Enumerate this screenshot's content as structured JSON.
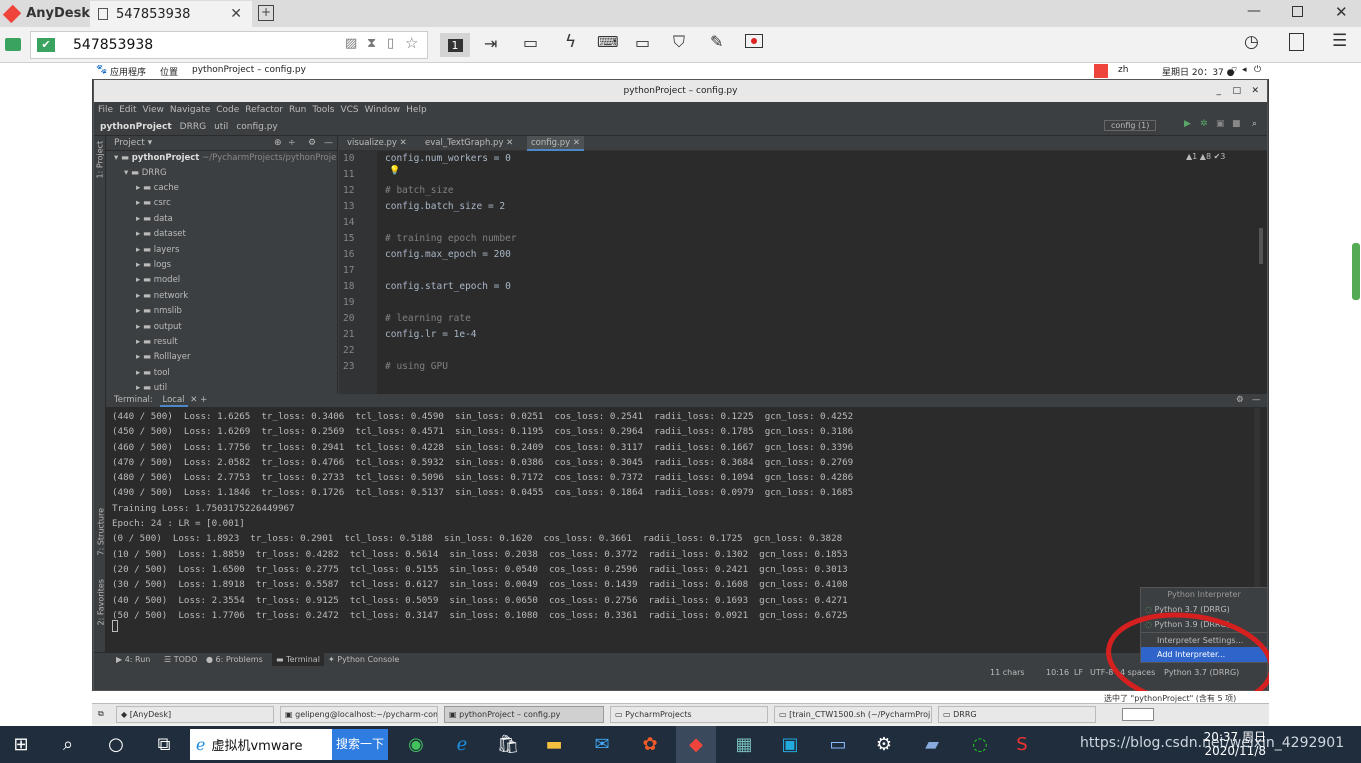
{
  "anydesk": {
    "app": "AnyDesk",
    "tab_id": "547853938",
    "address": "547853938",
    "monitor_num": "1"
  },
  "gnome": {
    "apps": "应用程序",
    "places": "位置",
    "window": "pythonProject – config.py",
    "lang": "zh",
    "clock": "星期日 20：37 ●"
  },
  "pycharm": {
    "title": "pythonProject – config.py",
    "menu": [
      "File",
      "Edit",
      "View",
      "Navigate",
      "Code",
      "Refactor",
      "Run",
      "Tools",
      "VCS",
      "Window",
      "Help"
    ],
    "breadcrumb": [
      "pythonProject",
      "DRRG",
      "util",
      "config.py"
    ],
    "run_config": "config (1)",
    "project_header": "Project",
    "root_name": "pythonProject",
    "root_path": "~/PycharmProjects/pythonProject",
    "drrg": "DRRG",
    "folders": [
      "cache",
      "csrc",
      "data",
      "dataset",
      "layers",
      "logs",
      "model",
      "network",
      "nmslib",
      "output",
      "result",
      "Rolllayer",
      "tool",
      "util"
    ],
    "tabs": [
      "visualize.py",
      "eval_TextGraph.py",
      "config.py"
    ],
    "inspect": "▲1 ▲8 ✔3",
    "lines": [
      {
        "n": "10",
        "code": "config.num_workers = 0"
      },
      {
        "n": "11",
        "code": ""
      },
      {
        "n": "12",
        "code": "# batch_size"
      },
      {
        "n": "13",
        "code": "config.batch_size = 2"
      },
      {
        "n": "14",
        "code": ""
      },
      {
        "n": "15",
        "code": "# training epoch number"
      },
      {
        "n": "16",
        "code": "config.max_epoch = 200"
      },
      {
        "n": "17",
        "code": ""
      },
      {
        "n": "18",
        "code": "config.start_epoch = 0"
      },
      {
        "n": "19",
        "code": ""
      },
      {
        "n": "20",
        "code": "# learning rate"
      },
      {
        "n": "21",
        "code": "config.lr = 1e-4"
      },
      {
        "n": "22",
        "code": ""
      },
      {
        "n": "23",
        "code": "# using GPU"
      }
    ],
    "terminal_label": "Terminal:",
    "terminal_tab": "Local",
    "term": [
      "(440 / 500)  Loss: 1.6265  tr_loss: 0.3406  tcl_loss: 0.4590  sin_loss: 0.0251  cos_loss: 0.2541  radii_loss: 0.1225  gcn_loss: 0.4252",
      "(450 / 500)  Loss: 1.6269  tr_loss: 0.2569  tcl_loss: 0.4571  sin_loss: 0.1195  cos_loss: 0.2964  radii_loss: 0.1785  gcn_loss: 0.3186",
      "(460 / 500)  Loss: 1.7756  tr_loss: 0.2941  tcl_loss: 0.4228  sin_loss: 0.2409  cos_loss: 0.3117  radii_loss: 0.1667  gcn_loss: 0.3396",
      "(470 / 500)  Loss: 2.0582  tr_loss: 0.4766  tcl_loss: 0.5932  sin_loss: 0.0386  cos_loss: 0.3045  radii_loss: 0.3684  gcn_loss: 0.2769",
      "(480 / 500)  Loss: 2.7753  tr_loss: 0.2733  tcl_loss: 0.5096  sin_loss: 0.7172  cos_loss: 0.7372  radii_loss: 0.1094  gcn_loss: 0.4286",
      "(490 / 500)  Loss: 1.1846  tr_loss: 0.1726  tcl_loss: 0.5137  sin_loss: 0.0455  cos_loss: 0.1864  radii_loss: 0.0979  gcn_loss: 0.1685",
      "Training Loss: 1.7503175226449967",
      "Epoch: 24 : LR = [0.001]",
      "(0 / 500)  Loss: 1.8923  tr_loss: 0.2901  tcl_loss: 0.5188  sin_loss: 0.1620  cos_loss: 0.3661  radii_loss: 0.1725  gcn_loss: 0.3828",
      "(10 / 500)  Loss: 1.8859  tr_loss: 0.4282  tcl_loss: 0.5614  sin_loss: 0.2038  cos_loss: 0.3772  radii_loss: 0.1302  gcn_loss: 0.1853",
      "(20 / 500)  Loss: 1.6500  tr_loss: 0.2775  tcl_loss: 0.5155  sin_loss: 0.0540  cos_loss: 0.2596  radii_loss: 0.2421  gcn_loss: 0.3013",
      "(30 / 500)  Loss: 1.8918  tr_loss: 0.5587  tcl_loss: 0.6127  sin_loss: 0.0049  cos_loss: 0.1439  radii_loss: 0.1608  gcn_loss: 0.4108",
      "(40 / 500)  Loss: 2.3554  tr_loss: 0.9125  tcl_loss: 0.5059  sin_loss: 0.0650  cos_loss: 0.2756  radii_loss: 0.1693  gcn_loss: 0.4271",
      "(50 / 500)  Loss: 1.7706  tr_loss: 0.2472  tcl_loss: 0.3147  sin_loss: 0.1080  cos_loss: 0.3361  radii_loss: 0.0921  gcn_loss: 0.6725"
    ],
    "popup": {
      "header": "Python Interpreter",
      "items": [
        "Python 3.7 (DRRG)",
        "Python 3.9 (DRRG)",
        "Interpreter Settings...",
        "Add Interpreter..."
      ]
    },
    "bottom_tabs": [
      "4: Run",
      "TODO",
      "6: Problems",
      "Terminal",
      "Python Console"
    ],
    "status": [
      "11 chars",
      "10:16",
      "LF",
      "UTF-8",
      "4 spaces",
      "Python 3.7 (DRRG)"
    ],
    "side": [
      "1: Project",
      "7: Structure",
      "2: Favorites"
    ]
  },
  "gnome_bottom": {
    "hint": "选中了 \"pythonProject\" (含有 5 项)",
    "tasks": [
      "[AnyDesk]",
      "gelipeng@localhost:~/pycharm-com...",
      "pythonProject – config.py",
      "PycharmProjects",
      "[train_CTW1500.sh (~/PycharmProj...",
      "DRRG"
    ]
  },
  "taskbar": {
    "search_label": "虚拟机vmware",
    "search_btn": "搜索一下",
    "time": "20:37 周日",
    "date": "2020/11/8",
    "watermark": "https://blog.csdn.net/weixin_4292901"
  }
}
